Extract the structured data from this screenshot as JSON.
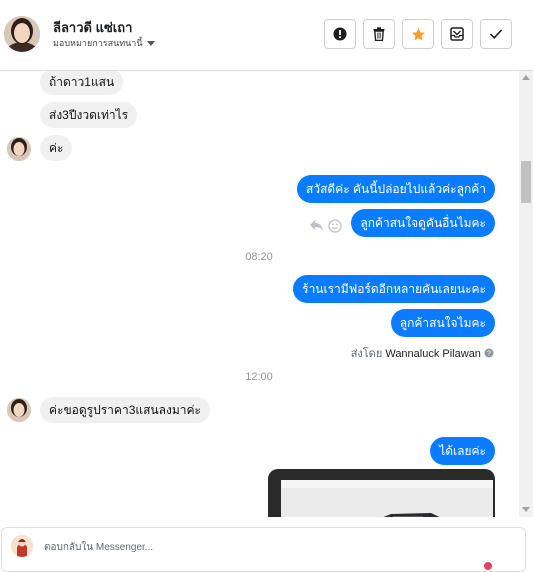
{
  "header": {
    "contact_name": "ลีลาวดี แซ่เถา",
    "assign_label": "มอบหมายการสนทนานี้",
    "actions": [
      {
        "name": "report-button",
        "icon": "exclamation-icon"
      },
      {
        "name": "delete-button",
        "icon": "trash-icon"
      },
      {
        "name": "star-button",
        "icon": "star-icon",
        "color": "#f7a12c"
      },
      {
        "name": "archive-button",
        "icon": "archive-icon"
      },
      {
        "name": "done-button",
        "icon": "check-icon"
      }
    ]
  },
  "messages": {
    "in_1": "ถ้าดาว1แสน",
    "in_2": "ส่ง3ปีงวดเท่าไร",
    "in_3": "ค่ะ",
    "out_1": "สวัสดีค่ะ คันนี้ปล่อยไปแล้วค่ะลูกค้า",
    "out_2": "ลูกค้าสนใจดูคันอื่นไมคะ",
    "time_1": "08:20",
    "out_3": "ร้านเรามีฟอร์ดอีกหลายคันเลยนะคะ",
    "out_4": "ลูกค้าสนใจไมคะ",
    "sent_by_prefix": "ส่งโดย",
    "sent_by_name": "Wannaluck Pilawan",
    "time_2": "12:00",
    "in_4": "ค่ะขอดูรูปราคา3แสนลงมาค่ะ",
    "out_5": "ได้เลยค่ะ"
  },
  "composer": {
    "placeholder": "ตอบกลับใน Messenger..."
  },
  "colors": {
    "outgoing_bubble": "#0a7cff",
    "incoming_bubble": "#f0f0f0",
    "star_accent": "#f7a12c"
  }
}
